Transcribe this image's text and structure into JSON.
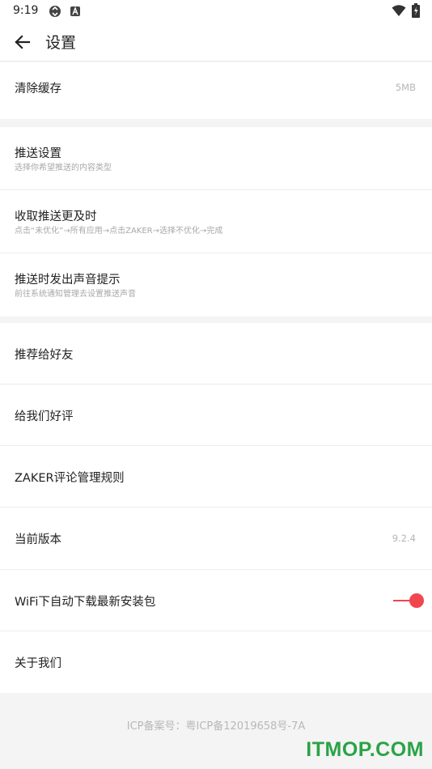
{
  "status_bar": {
    "time": "9:19"
  },
  "header": {
    "title": "设置"
  },
  "sections": {
    "cache": {
      "title": "清除缓存",
      "value": "5MB"
    },
    "push": [
      {
        "title": "推送设置",
        "subtitle": "选择你希望推送的内容类型"
      },
      {
        "title": "收取推送更及时",
        "subtitle": "点击“未优化”→所有应用→点击ZAKER→选择不优化→完成"
      },
      {
        "title": "推送时发出声音提示",
        "subtitle": "前往系统通知管理去设置推送声音"
      }
    ],
    "general": {
      "recommend": "推荐给好友",
      "rate": "给我们好评",
      "rules": "ZAKER评论管理规则",
      "version_label": "当前版本",
      "version_value": "9.2.4",
      "wifi_download": "WiFi下自动下载最新安装包",
      "wifi_download_enabled": true,
      "about": "关于我们"
    }
  },
  "footer": {
    "icp": "ICP备案号：粤ICP备12019658号-7A"
  },
  "watermark": "ITMOP.COM",
  "colors": {
    "accent": "#f2464f",
    "watermark": "#2aa346"
  }
}
